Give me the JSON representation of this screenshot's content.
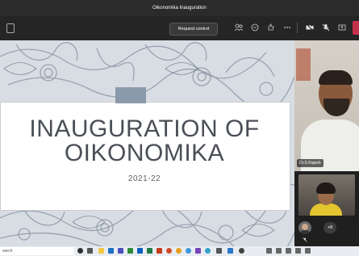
{
  "window": {
    "title": "Oikonomika Inauguration"
  },
  "toolbar": {
    "request_control_label": "Request control",
    "icons": [
      "people-icon",
      "chat-icon",
      "reactions-icon",
      "more-icon",
      "camera-off-icon",
      "mic-off-icon",
      "share-icon"
    ]
  },
  "slide": {
    "title_line1": "INAUGURATION OF",
    "title_line2": "OIKONOMIKA",
    "subtitle": "2021-22",
    "accent_color": "#8a9aab"
  },
  "participants": {
    "main_name": "Dr.S.Rajesh",
    "overflow_count": "+8"
  },
  "taskbar": {
    "search_placeholder": "earch"
  }
}
